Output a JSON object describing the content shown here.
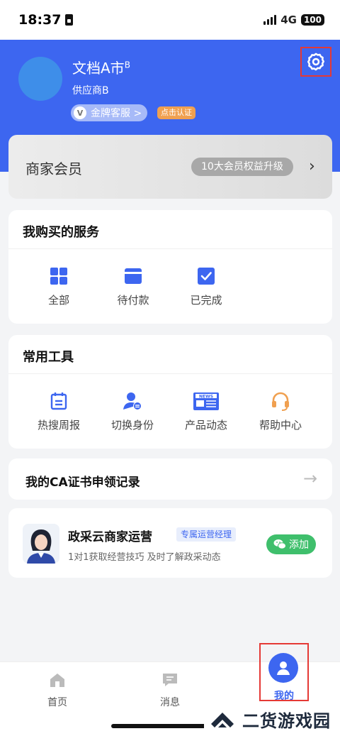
{
  "status": {
    "time": "18:37",
    "network": "4G",
    "battery": "100"
  },
  "profile": {
    "name": "文档A市",
    "name_sup": "B",
    "subtitle": "供应商B",
    "gold_service": "金牌客服 >",
    "verify": "点击认证"
  },
  "member": {
    "title": "商家会员",
    "upgrade": "10大会员权益升级"
  },
  "services": {
    "title": "我购买的服务",
    "items": [
      {
        "label": "全部",
        "icon": "grid-icon"
      },
      {
        "label": "待付款",
        "icon": "wallet-icon"
      },
      {
        "label": "已完成",
        "icon": "check-icon"
      }
    ]
  },
  "tools": {
    "title": "常用工具",
    "items": [
      {
        "label": "热搜周报",
        "icon": "calendar-icon"
      },
      {
        "label": "切换身份",
        "icon": "user-switch-icon"
      },
      {
        "label": "产品动态",
        "icon": "news-icon"
      },
      {
        "label": "帮助中心",
        "icon": "headset-icon"
      }
    ]
  },
  "ca": {
    "label": "我的CA证书申领记录"
  },
  "promo": {
    "title": "政采云商家运营",
    "tag": "专属运营经理",
    "desc": "1对1获取经营技巧 及时了解政采动态",
    "add": "添加"
  },
  "tabs": [
    {
      "label": "首页",
      "icon": "home-icon"
    },
    {
      "label": "消息",
      "icon": "message-icon"
    },
    {
      "label": "我的",
      "icon": "user-icon"
    }
  ],
  "watermark": {
    "text": "二货游戏园"
  },
  "colors": {
    "primary": "#3d66f0",
    "green": "#3fbf6c",
    "orange": "#f0a050",
    "highlight": "#e53935"
  }
}
